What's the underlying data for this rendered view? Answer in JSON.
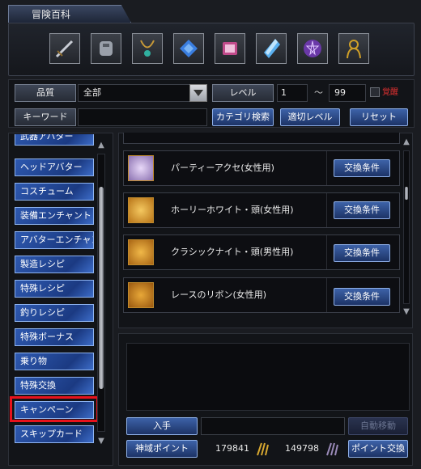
{
  "window": {
    "title": "冒険百科"
  },
  "category_icons": [
    {
      "name": "weapon-icon",
      "color": "#8c96a8"
    },
    {
      "name": "armor-icon",
      "color": "#a8adb6"
    },
    {
      "name": "necklace-icon",
      "color": "#c89a38"
    },
    {
      "name": "gem-icon",
      "color": "#3a7ee0"
    },
    {
      "name": "book-icon",
      "color": "#c04a8a"
    },
    {
      "name": "crystal-icon",
      "color": "#5ab0f0"
    },
    {
      "name": "orb-icon",
      "color": "#8a50c8"
    },
    {
      "name": "character-icon",
      "color": "#d0a028"
    }
  ],
  "filter": {
    "quality_label": "品質",
    "quality_value": "全部",
    "level_label": "レベル",
    "level_min": "1",
    "level_sep": "～",
    "level_max": "99",
    "awaken_label": "覚醒",
    "keyword_label": "キーワード",
    "keyword_value": "",
    "category_search": "カテゴリ検索",
    "suitable_level": "適切レベル",
    "reset": "リセット"
  },
  "categories": [
    "武器アバター",
    "ヘッドアバター",
    "コスチューム",
    "装備エンチャント",
    "アバターエンチャント",
    "製造レシピ",
    "特殊レシピ",
    "釣りレシピ",
    "特殊ボーナス",
    "乗り物",
    "特殊交換",
    "キャンペーン",
    "スキップカード"
  ],
  "selected_category": "キャンペーン",
  "items": [
    {
      "name": "パーティーアクセ(女性用)",
      "button": "交換条件"
    },
    {
      "name": "ホーリーホワイト・頭(女性用)",
      "button": "交換条件"
    },
    {
      "name": "クラシックナイト・頭(男性用)",
      "button": "交換条件"
    },
    {
      "name": "レースのリボン(女性用)",
      "button": "交換条件"
    }
  ],
  "bottom": {
    "obtain_label": "入手",
    "auto_move_label": "自動移動",
    "divine_points_label": "神域ポイント",
    "points_1": "179841",
    "points_2": "149798",
    "point_exchange": "ポイント交換"
  },
  "colors": {
    "highlight": "#e8121c",
    "awaken_text": "#e03030"
  }
}
